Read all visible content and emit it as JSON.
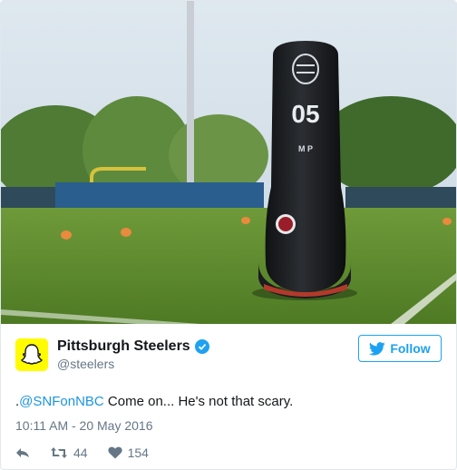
{
  "tweet": {
    "display_name": "Pittsburgh Steelers",
    "handle": "@steelers",
    "follow_label": "Follow",
    "text_prefix": ".",
    "mention": "@SNFonNBC",
    "text_rest": " Come on... He's not that scary.",
    "timestamp": "10:11 AM - 20 May 2016",
    "retweet_count": "44",
    "like_count": "154"
  },
  "photo": {
    "dummy_number": "05",
    "dummy_brand": "M P"
  },
  "colors": {
    "accent": "#1da1f2",
    "avatar_bg": "#fffc00",
    "verified": "#1da1f2"
  },
  "icons": [
    "snapchat-ghost-icon",
    "verified-badge-icon",
    "twitter-bird-icon",
    "reply-icon",
    "retweet-icon",
    "like-heart-icon"
  ]
}
